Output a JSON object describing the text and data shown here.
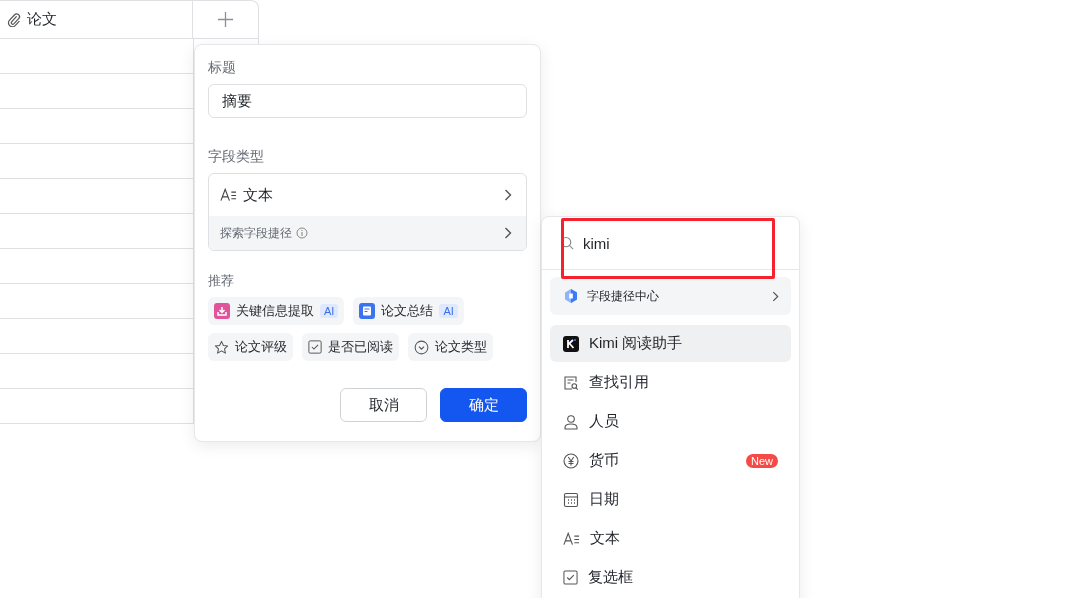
{
  "table": {
    "columns": [
      {
        "label": "论文",
        "kind": "attachment"
      },
      {
        "kind": "add"
      }
    ]
  },
  "field_dialog": {
    "title_label": "标题",
    "title_value": "摘要",
    "type_label": "字段类型",
    "type": {
      "label": "文本",
      "kind": "text"
    },
    "explore": "探索字段捷径",
    "recommend_label": "推荐",
    "recommendations": [
      {
        "label": "关键信息提取",
        "kind": "extract",
        "badge": "AI"
      },
      {
        "label": "论文总结",
        "kind": "summary",
        "badge": "AI"
      },
      {
        "label": "论文评级",
        "kind": "rating"
      },
      {
        "label": "是否已阅读",
        "kind": "checkbox"
      },
      {
        "label": "论文类型",
        "kind": "select"
      }
    ],
    "buttons": [
      {
        "label": "取消",
        "kind": "secondary"
      },
      {
        "label": "确定",
        "kind": "primary"
      }
    ]
  },
  "type_menu": {
    "search": {
      "value": "kimi",
      "highlighted": true
    },
    "shortcut_center": "字段捷径中心",
    "items": [
      {
        "label": "Kimi 阅读助手",
        "kind": "kimi",
        "selected": true
      },
      {
        "label": "查找引用",
        "kind": "citation",
        "selected": false
      },
      {
        "label": "人员",
        "kind": "person",
        "selected": false
      },
      {
        "label": "货币",
        "kind": "currency",
        "selected": false,
        "badge": "New"
      },
      {
        "label": "日期",
        "kind": "date",
        "selected": false
      },
      {
        "label": "文本",
        "kind": "text",
        "selected": false
      },
      {
        "label": "复选框",
        "kind": "checkbox",
        "selected": false
      }
    ]
  }
}
